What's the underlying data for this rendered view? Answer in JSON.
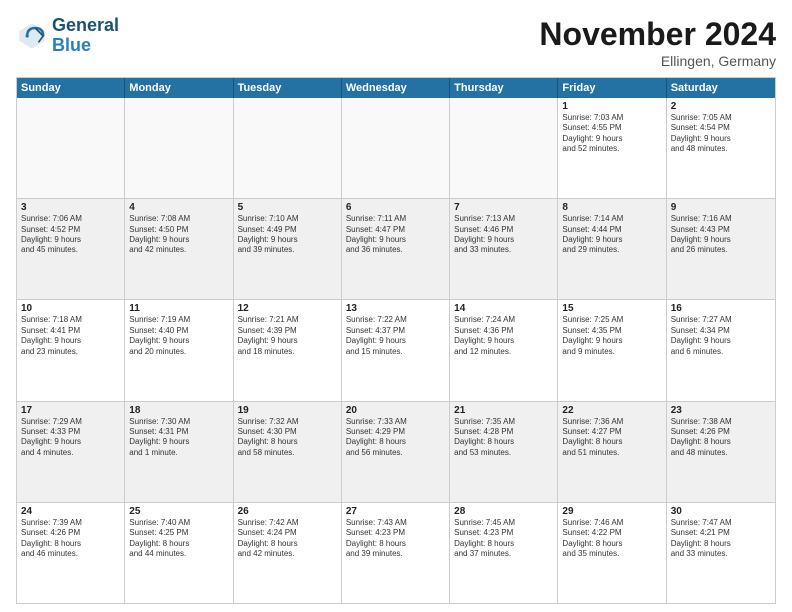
{
  "logo": {
    "line1": "General",
    "line2": "Blue"
  },
  "title": "November 2024",
  "location": "Ellingen, Germany",
  "header_days": [
    "Sunday",
    "Monday",
    "Tuesday",
    "Wednesday",
    "Thursday",
    "Friday",
    "Saturday"
  ],
  "weeks": [
    [
      {
        "day": "",
        "info": ""
      },
      {
        "day": "",
        "info": ""
      },
      {
        "day": "",
        "info": ""
      },
      {
        "day": "",
        "info": ""
      },
      {
        "day": "",
        "info": ""
      },
      {
        "day": "1",
        "info": "Sunrise: 7:03 AM\nSunset: 4:55 PM\nDaylight: 9 hours\nand 52 minutes."
      },
      {
        "day": "2",
        "info": "Sunrise: 7:05 AM\nSunset: 4:54 PM\nDaylight: 9 hours\nand 48 minutes."
      }
    ],
    [
      {
        "day": "3",
        "info": "Sunrise: 7:06 AM\nSunset: 4:52 PM\nDaylight: 9 hours\nand 45 minutes."
      },
      {
        "day": "4",
        "info": "Sunrise: 7:08 AM\nSunset: 4:50 PM\nDaylight: 9 hours\nand 42 minutes."
      },
      {
        "day": "5",
        "info": "Sunrise: 7:10 AM\nSunset: 4:49 PM\nDaylight: 9 hours\nand 39 minutes."
      },
      {
        "day": "6",
        "info": "Sunrise: 7:11 AM\nSunset: 4:47 PM\nDaylight: 9 hours\nand 36 minutes."
      },
      {
        "day": "7",
        "info": "Sunrise: 7:13 AM\nSunset: 4:46 PM\nDaylight: 9 hours\nand 33 minutes."
      },
      {
        "day": "8",
        "info": "Sunrise: 7:14 AM\nSunset: 4:44 PM\nDaylight: 9 hours\nand 29 minutes."
      },
      {
        "day": "9",
        "info": "Sunrise: 7:16 AM\nSunset: 4:43 PM\nDaylight: 9 hours\nand 26 minutes."
      }
    ],
    [
      {
        "day": "10",
        "info": "Sunrise: 7:18 AM\nSunset: 4:41 PM\nDaylight: 9 hours\nand 23 minutes."
      },
      {
        "day": "11",
        "info": "Sunrise: 7:19 AM\nSunset: 4:40 PM\nDaylight: 9 hours\nand 20 minutes."
      },
      {
        "day": "12",
        "info": "Sunrise: 7:21 AM\nSunset: 4:39 PM\nDaylight: 9 hours\nand 18 minutes."
      },
      {
        "day": "13",
        "info": "Sunrise: 7:22 AM\nSunset: 4:37 PM\nDaylight: 9 hours\nand 15 minutes."
      },
      {
        "day": "14",
        "info": "Sunrise: 7:24 AM\nSunset: 4:36 PM\nDaylight: 9 hours\nand 12 minutes."
      },
      {
        "day": "15",
        "info": "Sunrise: 7:25 AM\nSunset: 4:35 PM\nDaylight: 9 hours\nand 9 minutes."
      },
      {
        "day": "16",
        "info": "Sunrise: 7:27 AM\nSunset: 4:34 PM\nDaylight: 9 hours\nand 6 minutes."
      }
    ],
    [
      {
        "day": "17",
        "info": "Sunrise: 7:29 AM\nSunset: 4:33 PM\nDaylight: 9 hours\nand 4 minutes."
      },
      {
        "day": "18",
        "info": "Sunrise: 7:30 AM\nSunset: 4:31 PM\nDaylight: 9 hours\nand 1 minute."
      },
      {
        "day": "19",
        "info": "Sunrise: 7:32 AM\nSunset: 4:30 PM\nDaylight: 8 hours\nand 58 minutes."
      },
      {
        "day": "20",
        "info": "Sunrise: 7:33 AM\nSunset: 4:29 PM\nDaylight: 8 hours\nand 56 minutes."
      },
      {
        "day": "21",
        "info": "Sunrise: 7:35 AM\nSunset: 4:28 PM\nDaylight: 8 hours\nand 53 minutes."
      },
      {
        "day": "22",
        "info": "Sunrise: 7:36 AM\nSunset: 4:27 PM\nDaylight: 8 hours\nand 51 minutes."
      },
      {
        "day": "23",
        "info": "Sunrise: 7:38 AM\nSunset: 4:26 PM\nDaylight: 8 hours\nand 48 minutes."
      }
    ],
    [
      {
        "day": "24",
        "info": "Sunrise: 7:39 AM\nSunset: 4:26 PM\nDaylight: 8 hours\nand 46 minutes."
      },
      {
        "day": "25",
        "info": "Sunrise: 7:40 AM\nSunset: 4:25 PM\nDaylight: 8 hours\nand 44 minutes."
      },
      {
        "day": "26",
        "info": "Sunrise: 7:42 AM\nSunset: 4:24 PM\nDaylight: 8 hours\nand 42 minutes."
      },
      {
        "day": "27",
        "info": "Sunrise: 7:43 AM\nSunset: 4:23 PM\nDaylight: 8 hours\nand 39 minutes."
      },
      {
        "day": "28",
        "info": "Sunrise: 7:45 AM\nSunset: 4:23 PM\nDaylight: 8 hours\nand 37 minutes."
      },
      {
        "day": "29",
        "info": "Sunrise: 7:46 AM\nSunset: 4:22 PM\nDaylight: 8 hours\nand 35 minutes."
      },
      {
        "day": "30",
        "info": "Sunrise: 7:47 AM\nSunset: 4:21 PM\nDaylight: 8 hours\nand 33 minutes."
      }
    ]
  ]
}
